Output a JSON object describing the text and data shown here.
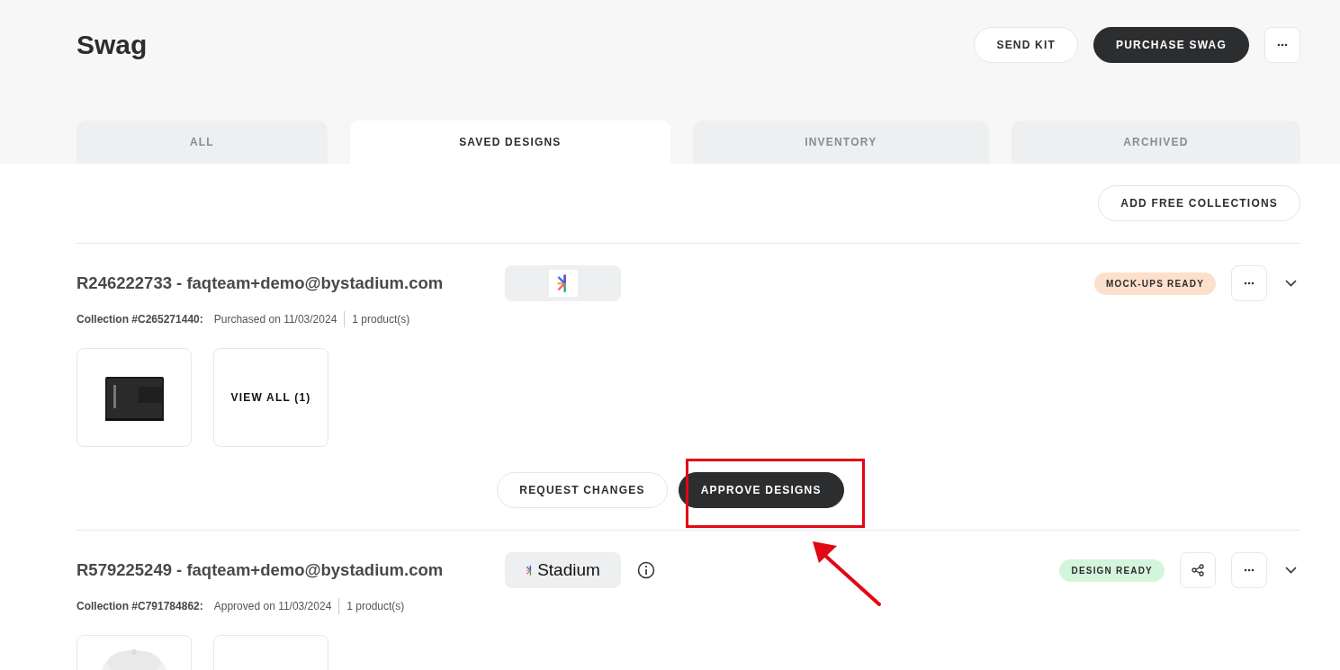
{
  "page": {
    "title": "Swag",
    "actions": [
      {
        "label": "SEND KIT",
        "kind": "outline"
      },
      {
        "label": "PURCHASE SWAG",
        "kind": "primary"
      },
      {
        "kind": "more"
      }
    ]
  },
  "tabs": [
    {
      "label": "ALL",
      "selected": false
    },
    {
      "label": "SAVED DESIGNS",
      "selected": true
    },
    {
      "label": "INVENTORY",
      "selected": false
    },
    {
      "label": "ARCHIVED",
      "selected": false
    }
  ],
  "toolbar": {
    "action": "ADD FREE COLLECTIONS"
  },
  "orders": [
    {
      "title": "R246222733 - faqteam+demo@bystadium.com",
      "brand": {
        "kind": "mark"
      },
      "info": false,
      "status": {
        "label": "MOCK-UPS READY",
        "color": "#fde0cc"
      },
      "share": false,
      "collection": "Collection #C265271440:",
      "event": "Purchased on 11/03/2024",
      "count": "1 product(s)",
      "items": [
        {
          "kind": "picture"
        },
        {
          "kind": "view_all",
          "label": "VIEW ALL (1)"
        }
      ],
      "actions": [
        {
          "label": "REQUEST CHANGES",
          "kind": "outline"
        },
        {
          "label": "APPROVE DESIGNS",
          "kind": "primary"
        }
      ]
    },
    {
      "title": "R579225249 - faqteam+demo@bystadium.com",
      "brand": {
        "kind": "wordmark",
        "label": "Stadium"
      },
      "info": true,
      "status": {
        "label": "DESIGN READY",
        "color": "#d3f5dc"
      },
      "share": true,
      "collection": "Collection #C791784862:",
      "event": "Approved on 11/03/2024",
      "count": "1 product(s)",
      "items": [
        {
          "kind": "picture"
        },
        {
          "kind": "blank"
        }
      ]
    }
  ]
}
